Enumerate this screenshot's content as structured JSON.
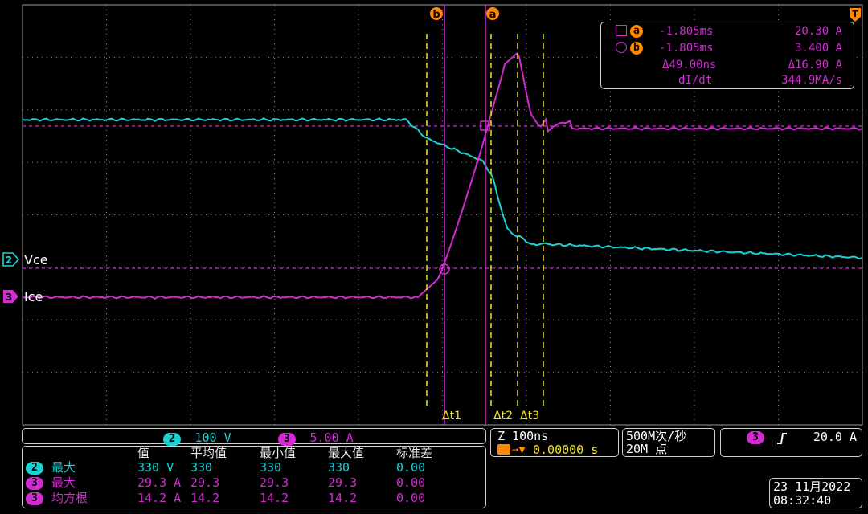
{
  "markers": {
    "b": "b",
    "a": "a",
    "trigger": "T"
  },
  "cursor_readout": {
    "row_a": {
      "icon": "square",
      "marker": "a",
      "time": "-1.805ms",
      "value": "20.30 A"
    },
    "row_b": {
      "icon": "circle",
      "marker": "b",
      "time": "-1.805ms",
      "value": "3.400 A"
    },
    "delta_time": "Δ49.00ns",
    "delta_value": "Δ16.90 A",
    "rate_label": "dI/dt",
    "rate_value": "344.9MA/s"
  },
  "channels": {
    "ch2": {
      "number": "2",
      "label": "Vce",
      "color": "#19d3d3",
      "scale": "100 V"
    },
    "ch3": {
      "number": "3",
      "label": "Ice",
      "color": "#d42ad4",
      "scale": "5.00 A"
    }
  },
  "delta_labels": {
    "t1": "Δt1",
    "t2": "Δt2",
    "t3": "Δt3"
  },
  "timebase": {
    "zoom": "Z 100ns",
    "position": "0.00000 s"
  },
  "acquisition": {
    "rate": "500M次/秒",
    "points": "20M 点"
  },
  "trigger": {
    "channel": "3",
    "slope_icon": "rising-edge-icon",
    "level": "20.0 A"
  },
  "measurements": {
    "headers": [
      "值",
      "平均值",
      "最小值",
      "最大值",
      "标准差"
    ],
    "rows": [
      {
        "channel": "2",
        "name": "最大",
        "color": "#19d3d3",
        "value": "330 V",
        "mean": "330",
        "min": "330",
        "max": "330",
        "std": "0.00"
      },
      {
        "channel": "3",
        "name": "最大",
        "color": "#d42ad4",
        "value": "29.3 A",
        "mean": "29.3",
        "min": "29.3",
        "max": "29.3",
        "std": "0.00"
      },
      {
        "channel": "3",
        "name": "均方根",
        "color": "#d42ad4",
        "value": "14.2 A",
        "mean": "14.2",
        "min": "14.2",
        "max": "14.2",
        "std": "0.00"
      }
    ]
  },
  "datetime": {
    "date": "23 11月2022",
    "time": "08:32:40"
  },
  "colors": {
    "cursor": "#f2e51d",
    "grid": "#8a8a8a",
    "trigger": "#ff8a00"
  }
}
